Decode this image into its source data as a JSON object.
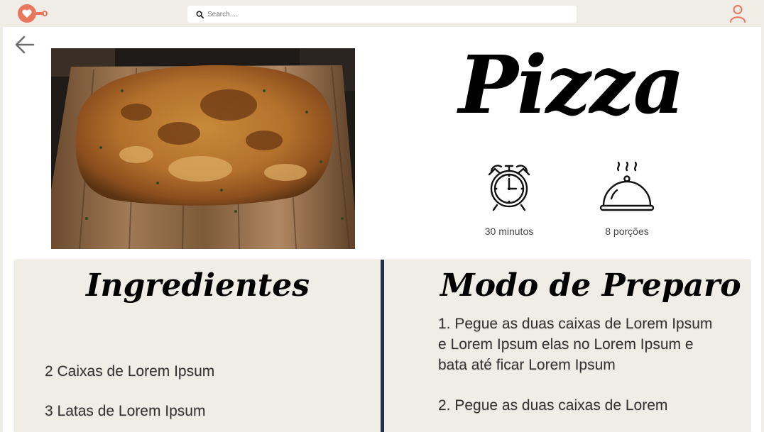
{
  "topbar": {
    "search_placeholder": "Search....",
    "accent_color": "#e8775d"
  },
  "recipe": {
    "title": "Pizza",
    "photo_alt": "Pizza",
    "time": "30 minutos",
    "servings": "8 porções"
  },
  "ingredients": {
    "heading": "Ingredientes",
    "items": [
      "2 Caixas de Lorem Ipsum",
      "3 Latas de Lorem Ipsum"
    ]
  },
  "preparation": {
    "heading": "Modo de Preparo",
    "steps": [
      "1. Pegue as duas caixas de Lorem Ipsum e Lorem Ipsum elas no Lorem Ipsum e bata até ficar Lorem Ipsum",
      "2. Pegue as duas caixas de Lorem"
    ]
  },
  "colors": {
    "background": "#f0ece6",
    "panel": "#ffffff",
    "divider": "#233349"
  }
}
